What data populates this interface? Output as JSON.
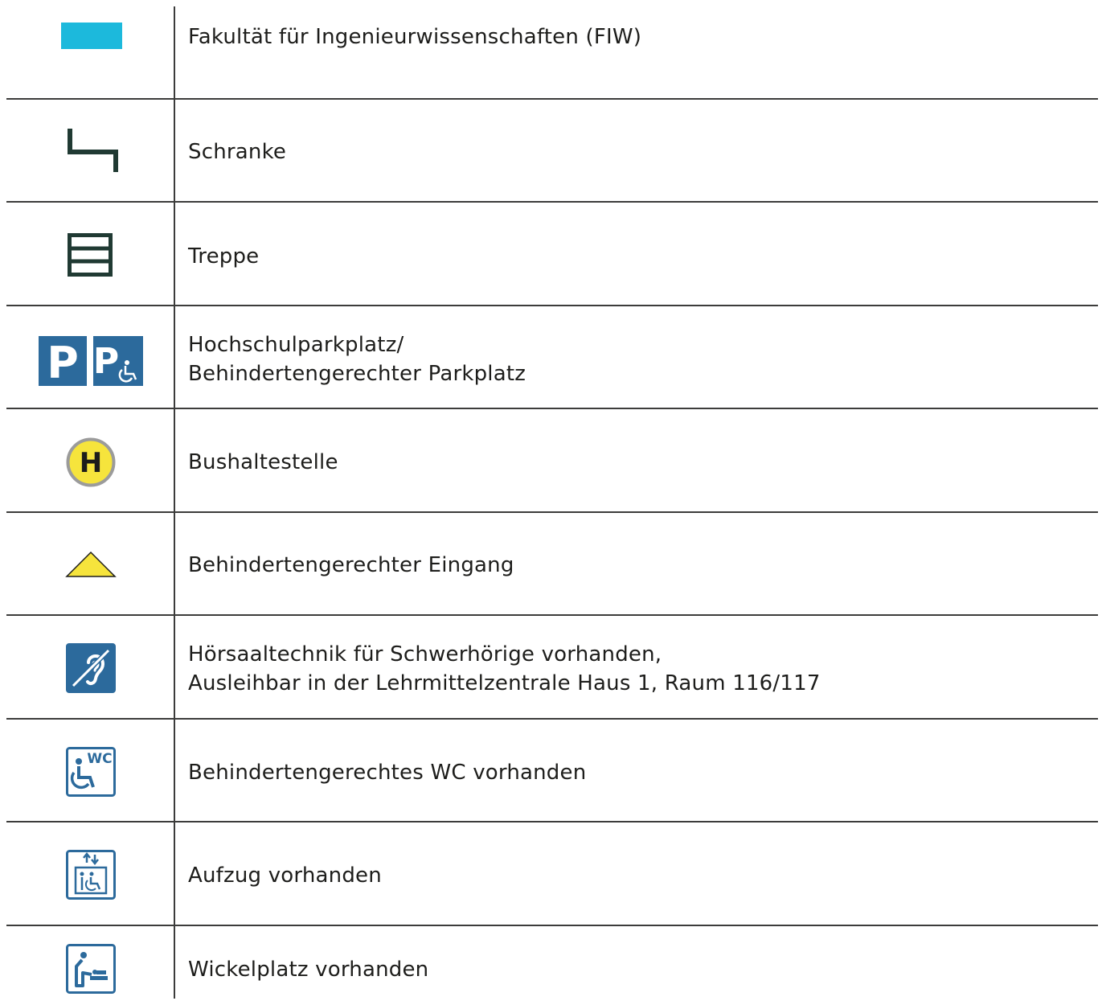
{
  "legend": {
    "rows": [
      {
        "label": "Fakultät für Ingenieurwissenschaften (FIW)",
        "icon": "faculty-color-swatch",
        "color": "#1cb9dc"
      },
      {
        "label": "Schranke",
        "icon": "barrier-icon",
        "color": "#203a33"
      },
      {
        "label": "Treppe",
        "icon": "stairs-icon",
        "color": "#203a33"
      },
      {
        "label": "Hochschulparkplatz/",
        "label2": "Behindertengerechter Parkplatz",
        "icon": "parking-icon",
        "color": "#2c6a9c"
      },
      {
        "label": "Bushaltestelle",
        "icon": "bus-stop-icon",
        "color": "#f6e43c"
      },
      {
        "label": "Behindertengerechter Eingang",
        "icon": "accessible-entrance-icon",
        "color": "#f6e43c"
      },
      {
        "label": "Hörsaaltechnik für Schwerhörige vorhanden,",
        "label2": "Ausleihbar in der Lehrmittelzentrale Haus 1, Raum 116/117",
        "icon": "hearing-assistance-icon",
        "color": "#2c6a9c"
      },
      {
        "label": "Behindertengerechtes WC vorhanden",
        "icon": "accessible-wc-icon",
        "color": "#2c6a9c"
      },
      {
        "label": "Aufzug vorhanden",
        "icon": "elevator-icon",
        "color": "#2c6a9c"
      },
      {
        "label": "Wickelplatz vorhanden",
        "icon": "baby-changing-icon",
        "color": "#2c6a9c"
      }
    ],
    "icon_text": {
      "parking": "P",
      "bus_stop": "H",
      "wc": "WC"
    }
  }
}
